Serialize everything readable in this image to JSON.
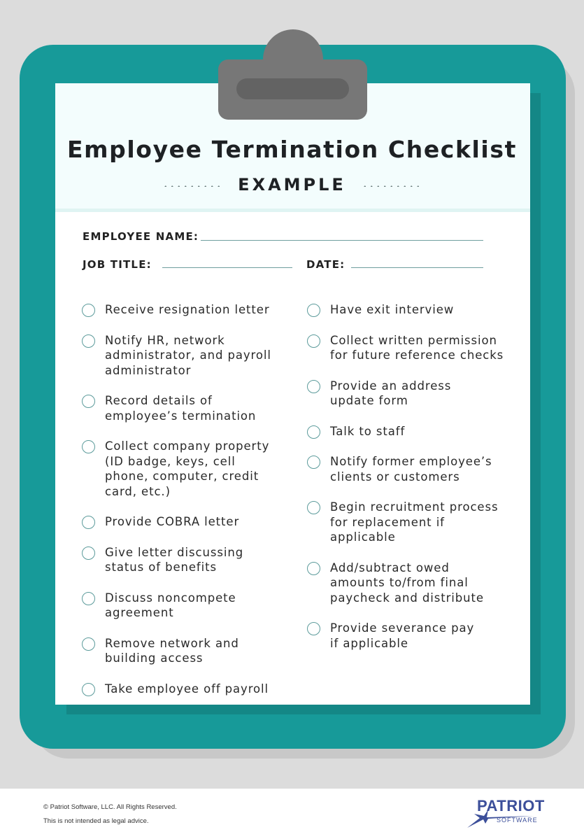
{
  "document": {
    "title": "Employee Termination Checklist",
    "subtitle": "EXAMPLE"
  },
  "fields": {
    "employee_name_label": "EMPLOYEE NAME:",
    "employee_name_value": "",
    "job_title_label": "JOB TITLE:",
    "job_title_value": "",
    "date_label": "DATE:",
    "date_value": ""
  },
  "checklist": {
    "left": [
      {
        "text": "Receive resignation letter",
        "checked": false
      },
      {
        "text": "Notify HR, network administrator, and payroll administrator",
        "checked": false
      },
      {
        "text": "Record details of employee’s termination",
        "checked": false
      },
      {
        "text": "Collect company property (ID badge, keys, cell phone, computer, credit card, etc.)",
        "checked": false
      },
      {
        "text": "Provide COBRA letter",
        "checked": false
      },
      {
        "text": "Give letter discussing status of benefits",
        "checked": false
      },
      {
        "text": "Discuss noncompete agreement",
        "checked": false
      },
      {
        "text": "Remove network and building access",
        "checked": false
      },
      {
        "text": "Take employee off payroll",
        "checked": false
      }
    ],
    "right": [
      {
        "text": "Have exit interview",
        "checked": false
      },
      {
        "text": "Collect written permission for future reference checks",
        "checked": false
      },
      {
        "text": "Provide an address update form",
        "checked": false
      },
      {
        "text": "Talk to staff",
        "checked": false
      },
      {
        "text": "Notify former employee’s clients or customers",
        "checked": false
      },
      {
        "text": "Begin recruitment process for replacement if applicable",
        "checked": false
      },
      {
        "text": "Add/subtract owed amounts to/from final paycheck and distribute",
        "checked": false
      },
      {
        "text": "Provide severance pay if applicable",
        "checked": false
      }
    ]
  },
  "footer": {
    "copyright": "© Patriot Software, LLC. All Rights Reserved.",
    "disclaimer": "This is not intended as legal advice.",
    "logo_word": "PATRIOT",
    "logo_sub": "SOFTWARE"
  },
  "colors": {
    "clipboard": "#179a99",
    "clip": "#777777",
    "logo": "#3c4f9a"
  }
}
